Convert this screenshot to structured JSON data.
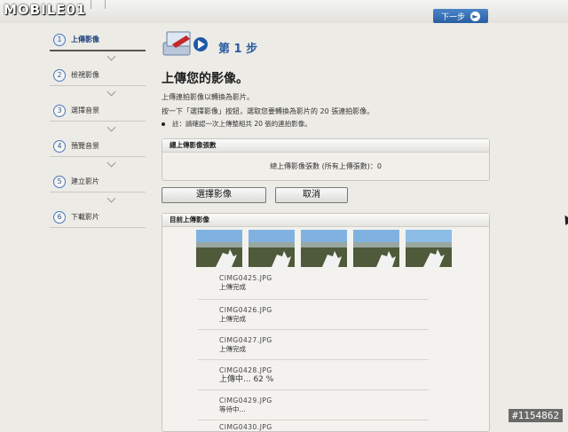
{
  "watermark": {
    "logo": "MOBILE01",
    "photo_id": "#1154862"
  },
  "toolbar": {
    "next_label": "下一步"
  },
  "sidebar": {
    "items": [
      {
        "num": "1",
        "label": "上傳影像"
      },
      {
        "num": "2",
        "label": "檢視影像"
      },
      {
        "num": "3",
        "label": "選擇音景"
      },
      {
        "num": "4",
        "label": "預覽音景"
      },
      {
        "num": "5",
        "label": "建立影片"
      },
      {
        "num": "6",
        "label": "下載影片"
      }
    ]
  },
  "main": {
    "step_title": "第 1 步",
    "page_title": "上傳您的影像。",
    "instruction_1": "上傳連拍影像以轉換為影片。",
    "instruction_2": "按一下「選擇影像」按鈕，選取您要轉換為影片的 20 張連拍影像。",
    "note": "註：請確認一次上傳整組共 20 張的連拍影像。",
    "count_panel": {
      "header": "總上傳影像張數",
      "text": "總上傳影像張數 (所有上傳張數)：0"
    },
    "buttons": {
      "select": "選擇影像",
      "cancel": "取消"
    },
    "upload_panel": {
      "header": "目前上傳影像",
      "files": [
        {
          "name": "CIMG0425.JPG",
          "status": "上傳完成"
        },
        {
          "name": "CIMG0426.JPG",
          "status": "上傳完成"
        },
        {
          "name": "CIMG0427.JPG",
          "status": "上傳完成"
        },
        {
          "name": "CIMG0428.JPG",
          "status": "上傳中... 62 %"
        },
        {
          "name": "CIMG0429.JPG",
          "status": "等待中..."
        },
        {
          "name": "CIMG0430.JPG",
          "status": ""
        }
      ]
    }
  },
  "colors": {
    "accent": "#2a5aa0",
    "next_button": "#2a5ea3"
  }
}
